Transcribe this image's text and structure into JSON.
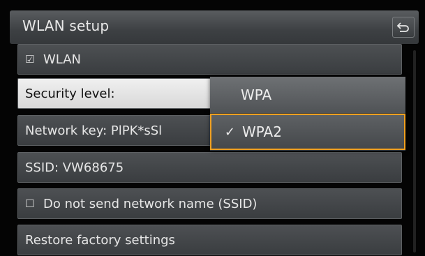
{
  "header": {
    "title": "WLAN setup",
    "back_icon": "back-arrow-icon"
  },
  "menu": {
    "wlan": {
      "checkbox": "☑",
      "label": "WLAN"
    },
    "security": {
      "label": "Security level:"
    },
    "network_key": {
      "label": "Network key: PlPK*sSl"
    },
    "ssid": {
      "label": "SSID: VW68675"
    },
    "hide_ssid": {
      "checkbox": "☐",
      "label": "Do not send network name (SSID)"
    },
    "restore": {
      "label": "Restore factory settings"
    }
  },
  "dropdown": {
    "options": [
      {
        "label": "WPA",
        "check": ""
      },
      {
        "label": "WPA2",
        "check": "✓"
      }
    ],
    "selected": "WPA2",
    "highlight_color": "#f0a020"
  }
}
